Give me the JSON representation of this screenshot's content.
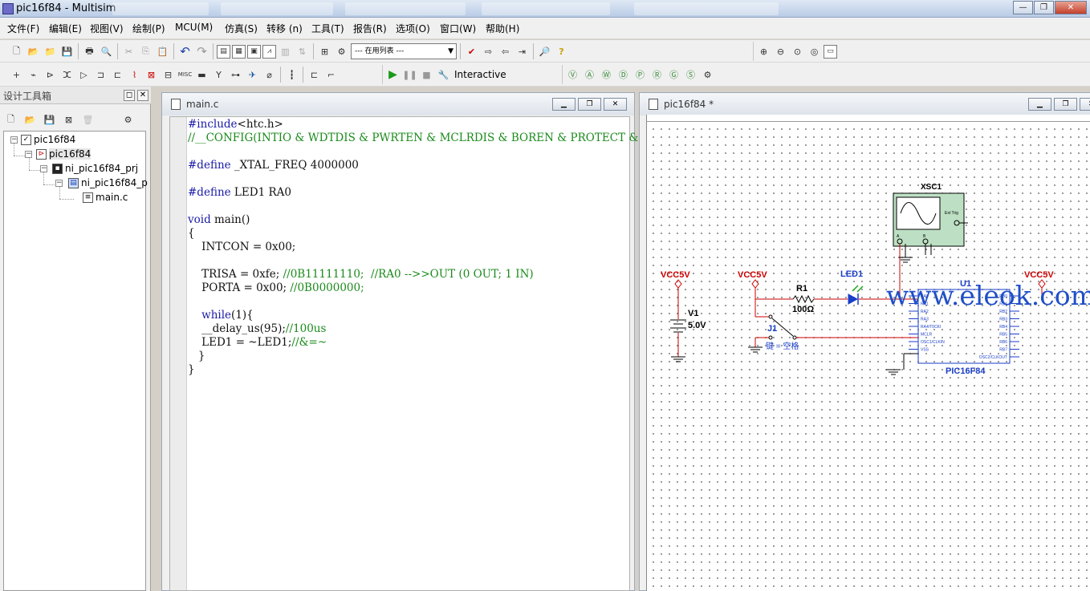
{
  "window": {
    "title": "pic16f84 - Multisim"
  },
  "menu": [
    "文件(F)",
    "编辑(E)",
    "视图(V)",
    "绘制(P)",
    "MCU(M)",
    "仿真(S)",
    "转移 (n)",
    "工具(T)",
    "报告(R)",
    "选项(O)",
    "窗口(W)",
    "帮助(H)"
  ],
  "toolbar": {
    "in_use_list": "--- 在用列表 ---",
    "interactive_label": "Interactive",
    "misc_label": "MISC"
  },
  "design_toolbox": {
    "title": "设计工具箱",
    "tree": {
      "root": "pic16f84",
      "design": "pic16f84",
      "project": "ni_pic16f84_prj",
      "subproject": "ni_pic16f84_p",
      "file": "main.c"
    }
  },
  "code_window": {
    "title": "main.c",
    "lines": [
      {
        "parts": [
          {
            "t": "#include",
            "c": "kw"
          },
          {
            "t": "<htc.h>",
            "c": ""
          }
        ]
      },
      {
        "parts": [
          {
            "t": "//__CONFIG(INTIO & WDTDIS & PWRTEN & MCLRDIS & BOREN & PROTECT & CPD)",
            "c": "cm"
          }
        ]
      },
      {
        "parts": []
      },
      {
        "parts": [
          {
            "t": "#define",
            "c": "kw"
          },
          {
            "t": " _XTAL_FREQ 4000000",
            "c": ""
          }
        ]
      },
      {
        "parts": []
      },
      {
        "parts": [
          {
            "t": "#define",
            "c": "kw"
          },
          {
            "t": " LED1 RA0",
            "c": ""
          }
        ]
      },
      {
        "parts": []
      },
      {
        "parts": [
          {
            "t": "void",
            "c": "kw"
          },
          {
            "t": " main()",
            "c": ""
          }
        ]
      },
      {
        "parts": [
          {
            "t": "{",
            "c": ""
          }
        ]
      },
      {
        "parts": [
          {
            "t": "    INTCON = 0x00;",
            "c": ""
          }
        ]
      },
      {
        "parts": []
      },
      {
        "parts": [
          {
            "t": "    TRISA = 0xfe; ",
            "c": ""
          },
          {
            "t": "//0B11111110;  //RA0 -->>OUT (0 OUT; 1 IN)",
            "c": "cm"
          }
        ]
      },
      {
        "parts": [
          {
            "t": "    PORTA = 0x00; ",
            "c": ""
          },
          {
            "t": "//0B0000000;",
            "c": "cm"
          }
        ]
      },
      {
        "parts": []
      },
      {
        "parts": [
          {
            "t": "    ",
            "c": ""
          },
          {
            "t": "while",
            "c": "kw"
          },
          {
            "t": "(1){",
            "c": ""
          }
        ]
      },
      {
        "parts": [
          {
            "t": "    __delay_us(95);",
            "c": ""
          },
          {
            "t": "//100us",
            "c": "cm"
          }
        ]
      },
      {
        "parts": [
          {
            "t": "    LED1 = ~LED1;",
            "c": ""
          },
          {
            "t": "//&=~",
            "c": "cm"
          }
        ]
      },
      {
        "parts": [
          {
            "t": "   }",
            "c": ""
          }
        ]
      },
      {
        "parts": [
          {
            "t": "}",
            "c": ""
          }
        ]
      }
    ]
  },
  "schematic_window": {
    "title": "pic16f84 *",
    "components": {
      "vcc_left": "VCC5V",
      "vcc_mid": "VCC5V",
      "vcc_right": "VCC5V",
      "v1_name": "V1",
      "v1_value": "5.0V",
      "r1_name": "R1",
      "r1_value": "100Ω",
      "led_name": "LED1",
      "switch_name": "J1",
      "switch_key": "键 = 空格",
      "scope_name": "XSC1",
      "scope_ext": "Ext Trig",
      "scope_a": "A",
      "scope_b": "B",
      "mcu_ref": "U1",
      "mcu_name": "PIC16F84",
      "mcu_pins_left": [
        "RA0",
        "RA1",
        "RA2",
        "RA3",
        "RA4/T0CKI",
        "MCLR",
        "OSC1/CLKIN",
        "VSS"
      ],
      "mcu_pins_right": [
        "RB0",
        "RB1",
        "RB2",
        "RB3",
        "RB4",
        "RB5",
        "RB6",
        "RB7",
        "OSC2/CLKOUT"
      ]
    },
    "watermark": "www.eleok.com"
  }
}
